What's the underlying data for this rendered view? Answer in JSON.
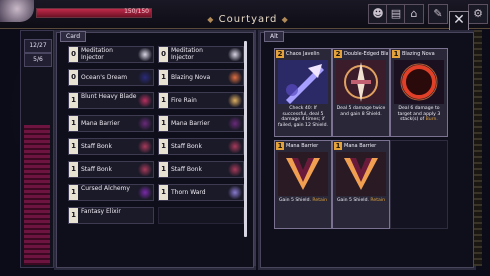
{
  "topbar": {
    "hp_text": "150/150",
    "location_title": "Courtyard"
  },
  "stats": {
    "ratio": "12/27",
    "count": "5/6"
  },
  "tabs": {
    "card": "Card",
    "alt": "Alt"
  },
  "deck": [
    {
      "count": "0",
      "name": "Meditation Injector",
      "art_color": "#d8d4e4"
    },
    {
      "count": "0",
      "name": "Meditation Injector",
      "art_color": "#d8d4e4"
    },
    {
      "count": "0",
      "name": "Ocean's Dream",
      "art_color": "#2a2a7a"
    },
    {
      "count": "1",
      "name": "Blazing Nova",
      "art_color": "#e07040"
    },
    {
      "count": "1",
      "name": "Blunt Heavy Blade",
      "art_color": "#b83060"
    },
    {
      "count": "1",
      "name": "Fire Rain",
      "art_color": "#e0b060"
    },
    {
      "count": "1",
      "name": "Mana Barrier",
      "art_color": "#6a2a7a"
    },
    {
      "count": "1",
      "name": "Mana Barrier",
      "art_color": "#6a2a7a"
    },
    {
      "count": "1",
      "name": "Staff Bonk",
      "art_color": "#a83a5a"
    },
    {
      "count": "1",
      "name": "Staff Bonk",
      "art_color": "#a83a5a"
    },
    {
      "count": "1",
      "name": "Staff Bonk",
      "art_color": "#a83a5a"
    },
    {
      "count": "1",
      "name": "Staff Bonk",
      "art_color": "#a83a5a"
    },
    {
      "count": "1",
      "name": "Cursed Alchemy",
      "art_color": "#7a2aa8"
    },
    {
      "count": "1",
      "name": "Thorn Ward",
      "art_color": "#8a7ad0"
    },
    {
      "count": "1",
      "name": "Fantasy Elixir",
      "art_color": ""
    }
  ],
  "alt_cards": [
    {
      "cost": "2",
      "name": "Chaos Javelin",
      "text": "Check 40: If successful, deal 5 damage 4 times; if failed, gain 12 Shield.",
      "keyword": "",
      "art": "javelin"
    },
    {
      "cost": "2",
      "name": "Double-Edged Blade",
      "text": "Deal 5 damage twice and gain 8 Shield.",
      "keyword": "",
      "art": "blade"
    },
    {
      "cost": "1",
      "name": "Blazing Nova",
      "text": "Deal 6 damage to target and apply 3 stack(s) of",
      "keyword": "Burn.",
      "art": "nova"
    },
    {
      "cost": "1",
      "name": "Mana Barrier",
      "text": "Gain 5 Shield.",
      "keyword": "Retain",
      "art": "barrier"
    },
    {
      "cost": "1",
      "name": "Mana Barrier",
      "text": "Gain 5 Shield.",
      "keyword": "Retain",
      "art": "barrier"
    }
  ],
  "colors": {
    "accent_gold": "#e6a23a",
    "hp_red": "#c0294a"
  }
}
